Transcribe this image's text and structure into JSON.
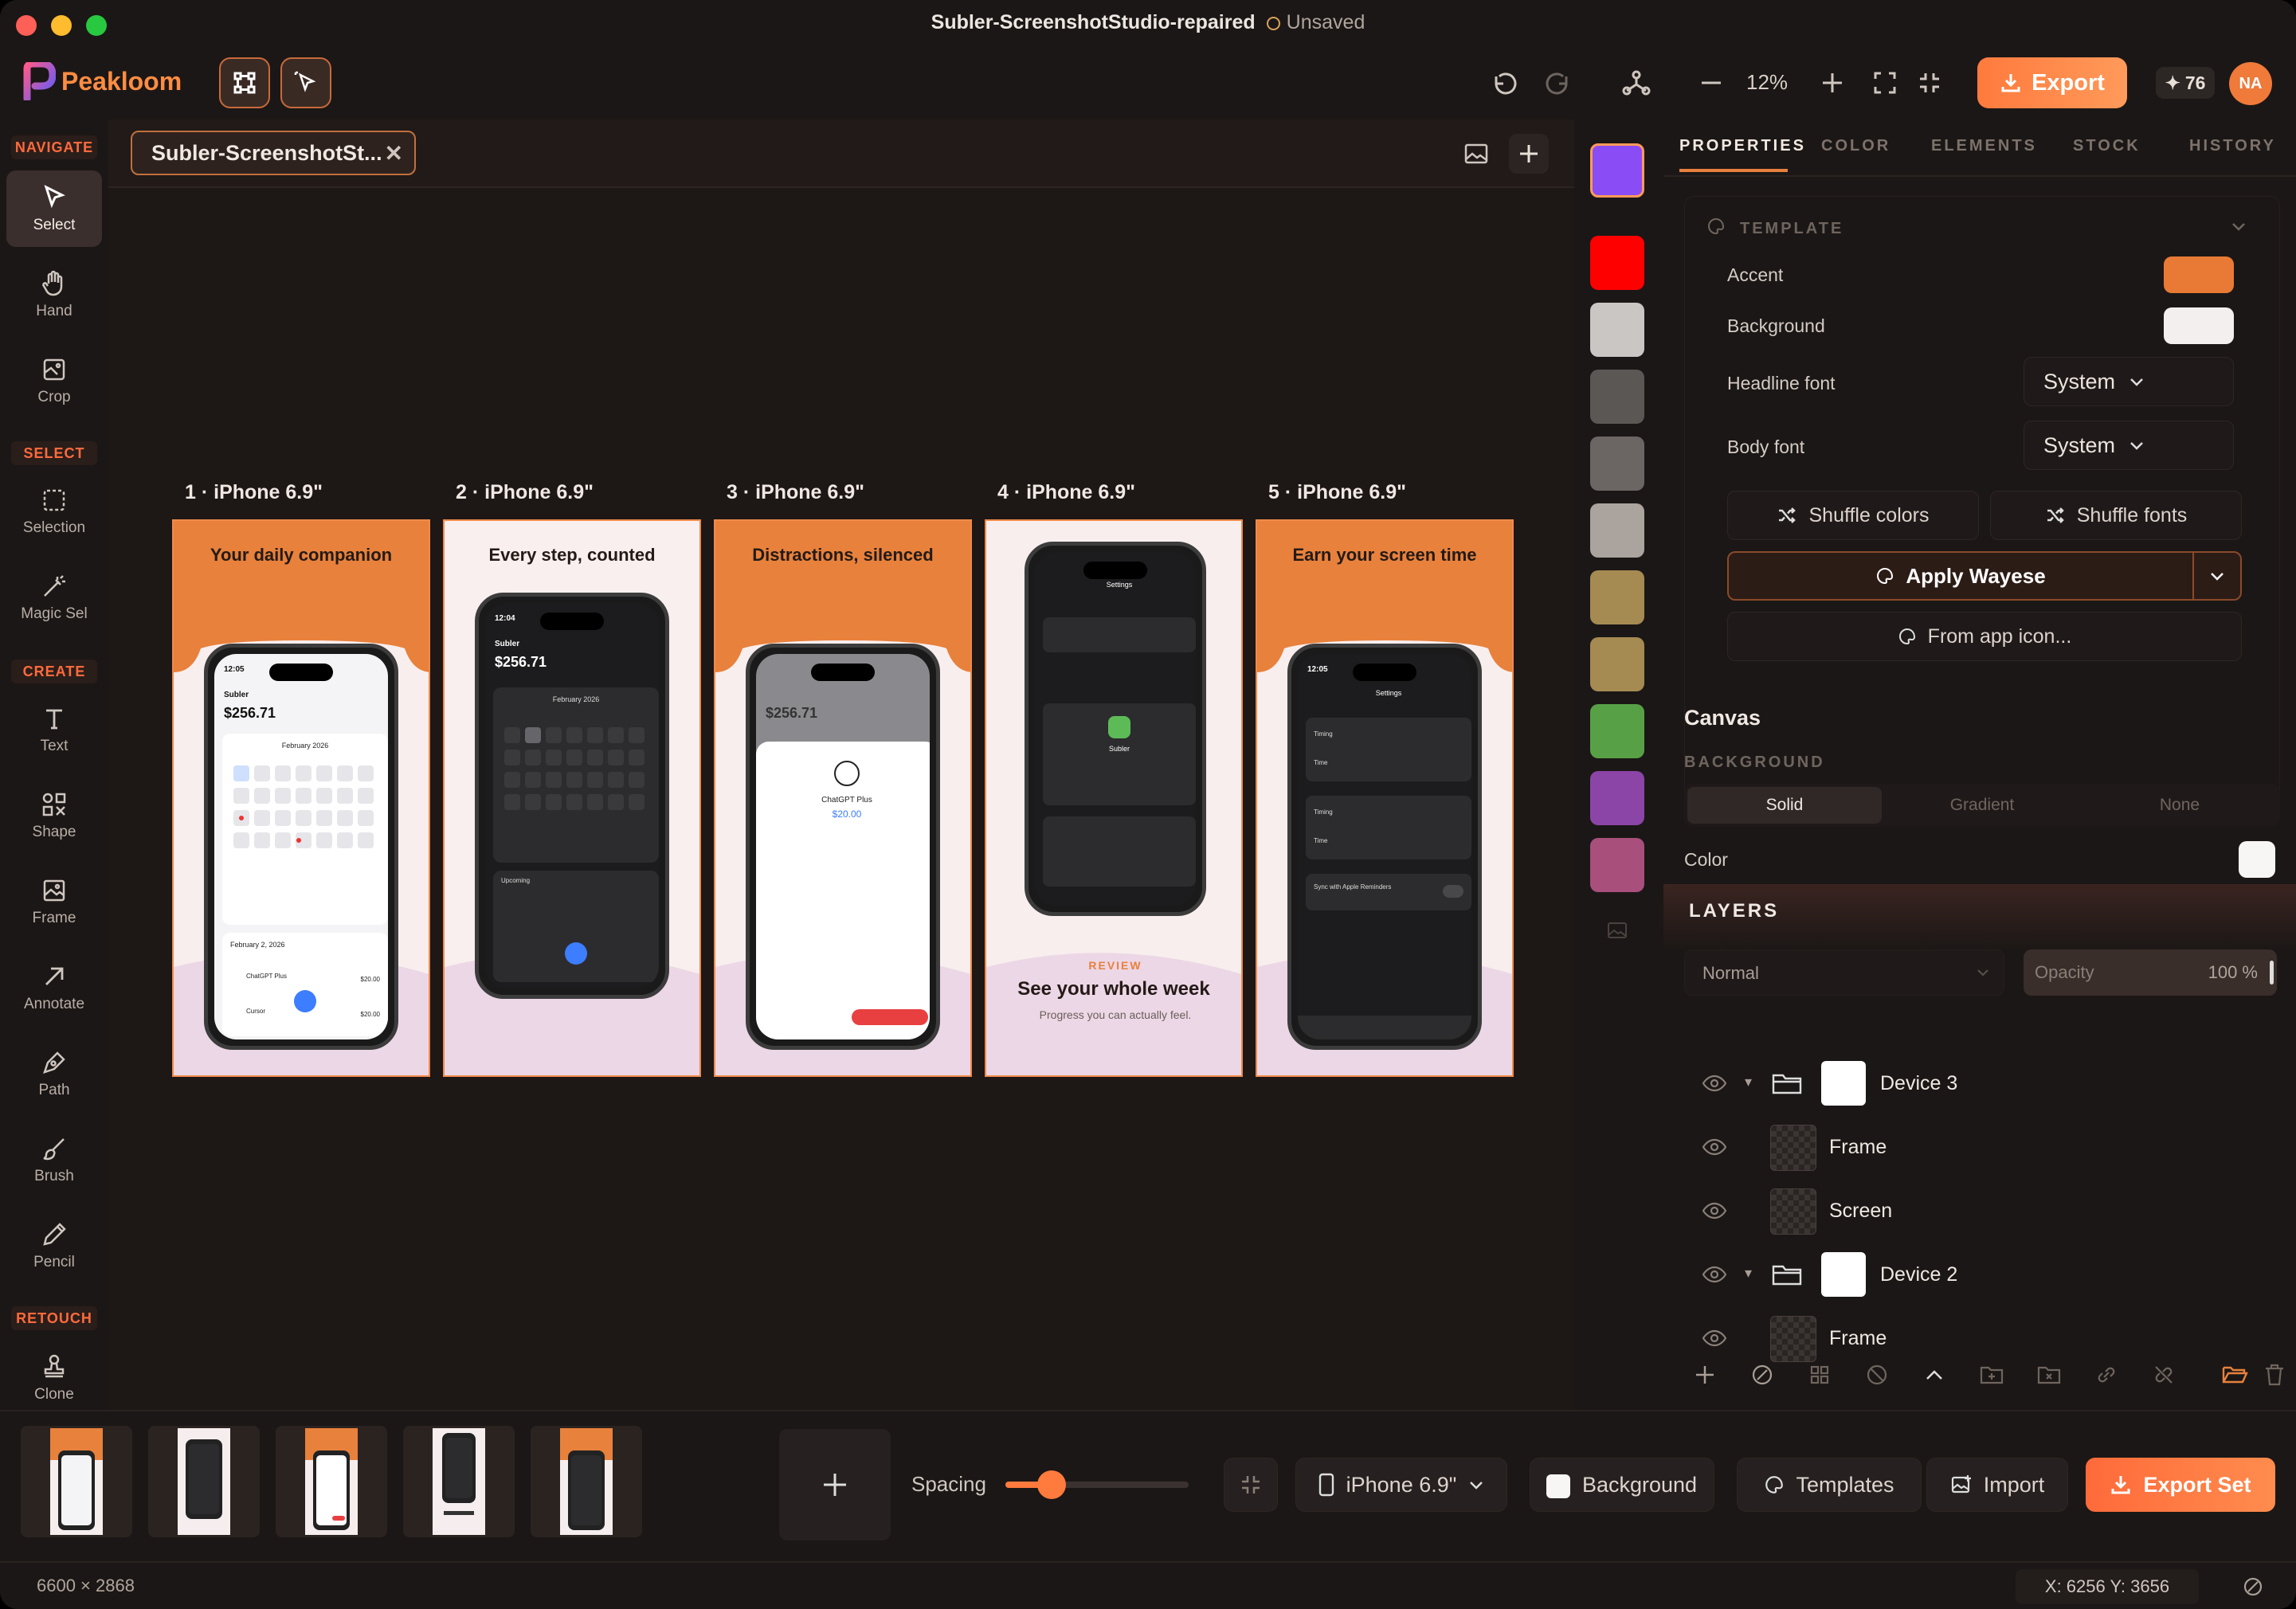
{
  "window": {
    "title": "Subler-ScreenshotStudio-repaired",
    "save_status": "Unsaved"
  },
  "app": {
    "name": "Peakloom"
  },
  "toolbar": {
    "zoom": "12%",
    "export_label": "Export",
    "credits": "76",
    "avatar_initials": "NA"
  },
  "rail": {
    "sections": [
      "NAVIGATE",
      "SELECT",
      "CREATE",
      "RETOUCH"
    ],
    "tools": [
      {
        "label": "Select",
        "icon": "cursor-icon",
        "active": true
      },
      {
        "label": "Hand",
        "icon": "hand-icon"
      },
      {
        "label": "Crop",
        "icon": "crop-icon"
      },
      {
        "label": "Selection",
        "icon": "selection-icon"
      },
      {
        "label": "Magic Sel",
        "icon": "magic-wand-icon"
      },
      {
        "label": "Text",
        "icon": "text-icon"
      },
      {
        "label": "Shape",
        "icon": "shape-icon"
      },
      {
        "label": "Frame",
        "icon": "frame-icon"
      },
      {
        "label": "Annotate",
        "icon": "arrow-icon"
      },
      {
        "label": "Path",
        "icon": "pen-icon"
      },
      {
        "label": "Brush",
        "icon": "brush-icon"
      },
      {
        "label": "Pencil",
        "icon": "pencil-icon"
      },
      {
        "label": "Clone",
        "icon": "stamp-icon"
      }
    ]
  },
  "canvas": {
    "tab_title": "Subler-ScreenshotSt...",
    "screens": [
      {
        "label": "1 · iPhone 6.9\"",
        "headline": "Your daily companion"
      },
      {
        "label": "2 · iPhone 6.9\"",
        "headline": "Every step, counted"
      },
      {
        "label": "3 · iPhone 6.9\"",
        "headline": "Distractions, silenced"
      },
      {
        "label": "4 · iPhone 6.9\"",
        "headline": "See your whole week",
        "kicker": "REVIEW",
        "sub": "Progress you can actually feel."
      },
      {
        "label": "5 · iPhone 6.9\"",
        "headline": "Earn your screen time"
      }
    ],
    "phone_text": {
      "time1": "12:05",
      "time2": "12:04",
      "app": "Subler",
      "amount": "$256.71",
      "month": "February 2026",
      "date_heading": "February 2, 2026",
      "item1": "ChatGPT Plus",
      "item2": "Cursor",
      "price1": "$20.00",
      "price2": "$20.00",
      "upcoming": "Upcoming",
      "settings": "Settings",
      "price_big": "$20.00",
      "sync": "Sync with Apple Reminders",
      "timing": "Timing",
      "time_lbl": "Time"
    }
  },
  "swatches": [
    "#8a4cf5",
    "#ff0000",
    "#c9c6c4",
    "#5b5755",
    "#6b6563",
    "#aaa39e",
    "#a58a52",
    "#a58a52",
    "#58a046",
    "#8b45a6",
    "#a84f7c"
  ],
  "panel": {
    "tabs": [
      "PROPERTIES",
      "COLOR",
      "ELEMENTS",
      "STOCK",
      "HISTORY"
    ],
    "template_title": "TEMPLATE",
    "accent_label": "Accent",
    "accent_color": "#e87a35",
    "background_label": "Background",
    "background_color": "#f3efee",
    "headline_font_label": "Headline font",
    "headline_font": "System",
    "body_font_label": "Body font",
    "body_font": "System",
    "shuffle_colors": "Shuffle colors",
    "shuffle_fonts": "Shuffle fonts",
    "apply_label": "Apply Wayese",
    "from_icon": "From app icon...",
    "canvas_title": "Canvas",
    "bg_section": "BACKGROUND",
    "bg_options": [
      "Solid",
      "Gradient",
      "None"
    ],
    "color_label": "Color",
    "layers_title": "LAYERS",
    "blend_mode": "Normal",
    "opacity_label": "Opacity",
    "opacity_value": "100 %",
    "layers": [
      {
        "name": "Device 3",
        "type": "group"
      },
      {
        "name": "Frame",
        "type": "item"
      },
      {
        "name": "Screen",
        "type": "item"
      },
      {
        "name": "Device 2",
        "type": "group"
      },
      {
        "name": "Frame",
        "type": "item"
      }
    ]
  },
  "bottom": {
    "spacing_label": "Spacing",
    "spacing_value": 0.25,
    "device": "iPhone 6.9\"",
    "background": "Background",
    "templates": "Templates",
    "import": "Import",
    "export_set": "Export Set"
  },
  "status": {
    "dimensions": "6600 × 2868",
    "coords": "X: 6256  Y: 3656"
  }
}
